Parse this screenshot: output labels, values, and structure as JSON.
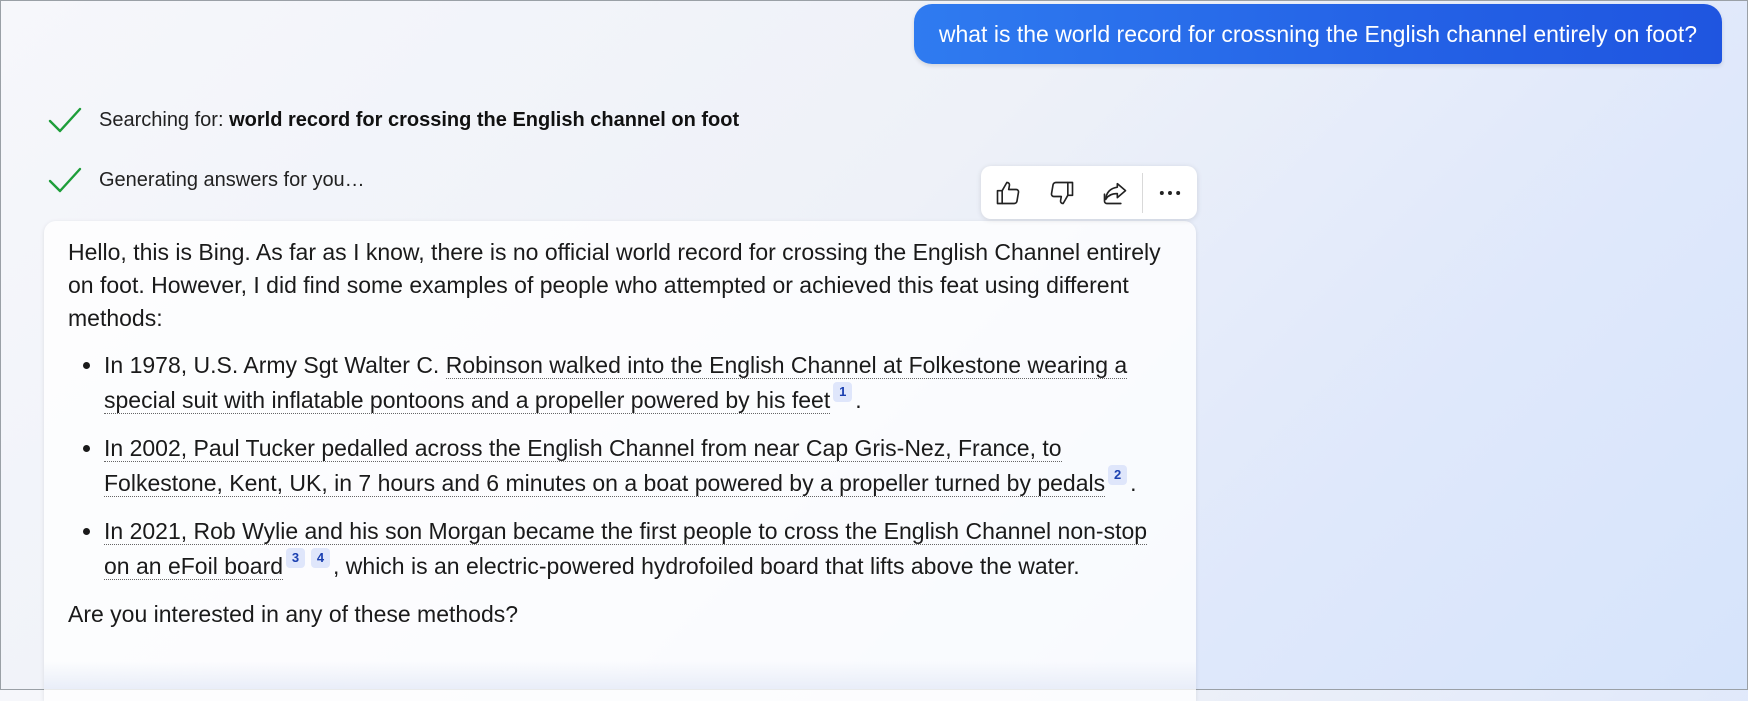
{
  "user_message": "what is the world record for crossning the English channel entirely on foot?",
  "status": {
    "searching_prefix": "Searching for: ",
    "searching_query": "world record for crossing the English channel on foot",
    "generating": "Generating answers for you…"
  },
  "toolbar": {
    "like": "thumbs-up-icon",
    "dislike": "thumbs-down-icon",
    "share": "share-icon",
    "more": "more-options-icon"
  },
  "answer": {
    "intro": "Hello, this is Bing. As far as I know, there is no official world record for crossing the English Channel entirely on foot. However, I did find some examples of people who attempted or achieved this feat using different methods:",
    "bullets": [
      {
        "pre": "In 1978, U.S. Army Sgt Walter C. ",
        "cited": "Robinson walked into the English Channel at Folkestone wearing a special suit with inflatable pontoons and a propeller powered by his feet",
        "refs": [
          "1"
        ],
        "post": "."
      },
      {
        "pre": "",
        "cited": "In 2002, Paul Tucker pedalled across the English Channel from near Cap Gris-Nez, France, to Folkestone, Kent, UK, in 7 hours and 6 minutes on a boat powered by a propeller turned by pedals",
        "refs": [
          "2"
        ],
        "post": "."
      },
      {
        "pre": "",
        "cited": "In 2021, Rob Wylie and his son Morgan became the first people to cross the English Channel non-stop on an eFoil board",
        "refs": [
          "3",
          "4"
        ],
        "post": ", which is an electric-powered hydrofoiled board that lifts above the water."
      }
    ],
    "closing": "Are you interested in any of these methods?"
  },
  "colors": {
    "user_bubble": "#2462e6",
    "check": "#1e9e3a",
    "citation_bg": "#dfe6fb"
  }
}
